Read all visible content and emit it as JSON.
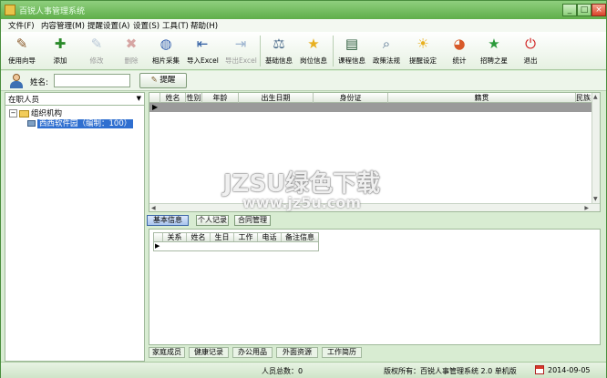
{
  "window": {
    "title": "百锐人事管理系统",
    "minimize": "_",
    "maximize": "□",
    "close": "×"
  },
  "menu": [
    "文件(F)",
    "内容管理(M)",
    "提醒设置(A)",
    "设置(S)",
    "工具(T)",
    "帮助(H)"
  ],
  "toolbar": [
    {
      "label": "使用向导",
      "icon": "wand-icon",
      "glyph": "✎",
      "enabled": true
    },
    {
      "label": "添加",
      "icon": "add-person-icon",
      "glyph": "✚",
      "enabled": true
    },
    {
      "label": "修改",
      "icon": "edit-icon",
      "glyph": "✎",
      "enabled": false
    },
    {
      "label": "删除",
      "icon": "delete-icon",
      "glyph": "✖",
      "enabled": false
    },
    {
      "label": "相片采集",
      "icon": "photo-icon",
      "glyph": "◍",
      "enabled": true
    },
    {
      "label": "导入Excel",
      "icon": "import-icon",
      "glyph": "⇤",
      "enabled": true
    },
    {
      "label": "导出Excel",
      "icon": "export-icon",
      "glyph": "⇥",
      "enabled": false
    },
    {
      "label": "基础信息",
      "icon": "scale-icon",
      "glyph": "⚖",
      "enabled": true
    },
    {
      "label": "岗位信息",
      "icon": "star-icon",
      "glyph": "★",
      "enabled": true
    },
    {
      "label": "课程信息",
      "icon": "board-icon",
      "glyph": "▤",
      "enabled": true
    },
    {
      "label": "政策法规",
      "icon": "magnifier-icon",
      "glyph": "⌕",
      "enabled": true
    },
    {
      "label": "提醒设定",
      "icon": "bulb-icon",
      "glyph": "☀",
      "enabled": true
    },
    {
      "label": "统计",
      "icon": "pie-chart-icon",
      "glyph": "◕",
      "enabled": true
    },
    {
      "label": "招聘之星",
      "icon": "green-star-icon",
      "glyph": "★",
      "enabled": true
    },
    {
      "label": "退出",
      "icon": "power-icon",
      "glyph": "⏻",
      "enabled": true
    }
  ],
  "search": {
    "label": "姓名:",
    "value": "",
    "button": "提醒"
  },
  "left": {
    "combo": "在职人员",
    "root": "组织机构",
    "unit": "西西软件园（编制：100）"
  },
  "grid": {
    "columns": [
      "姓名",
      "性别",
      "年龄",
      "出生日期",
      "身份证",
      "籍贯",
      "民族"
    ]
  },
  "tabs_top": [
    "基本信息",
    "个人记录",
    "合同管理"
  ],
  "detail": {
    "columns": [
      "关系",
      "姓名",
      "生日",
      "工作",
      "电话",
      "备注信息"
    ]
  },
  "tabs_bottom": [
    "家庭成员",
    "健康记录",
    "办公用品",
    "外面资源",
    "工作简历"
  ],
  "status": {
    "count": "人员总数：0",
    "copyright": "版权所有：百锐人事管理系统 2.0 单机版",
    "date": "2014-09-05"
  },
  "watermark": {
    "line1": "JZSU绿色下载",
    "line2": "www.jz5u.com"
  }
}
